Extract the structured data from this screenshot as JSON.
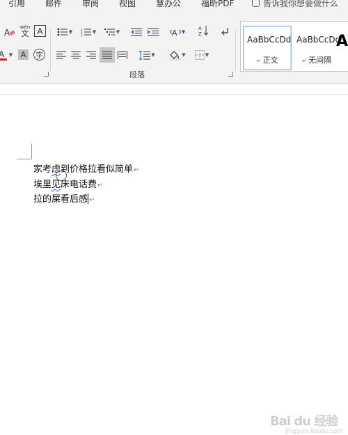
{
  "tabs": [
    "引用",
    "邮件",
    "审阅",
    "视图",
    "慧办公",
    "福昕PDF"
  ],
  "tell_me": "告诉我你想要做什么",
  "font_group": {
    "phonetic_label": "wén",
    "phonetic_char": "文",
    "border_char": "A",
    "shade_char": "A",
    "enclose_char": "字"
  },
  "paragraph_group": {
    "label": "段落",
    "sort_label": "A↓Z"
  },
  "styles": [
    {
      "sample": "AaBbCcDd",
      "name": "正文",
      "active": true
    },
    {
      "sample": "AaBbCcDd",
      "name": "无间隔",
      "active": false
    }
  ],
  "document": {
    "lines": [
      {
        "pre": "家考",
        "squiggle": "虑",
        "post": "到价格拉看似简单"
      },
      {
        "pre": "埃里",
        "squiggle": "见",
        "post": "床电话费"
      },
      {
        "pre": "拉的屎看后感",
        "squiggle": "",
        "post": ""
      }
    ],
    "return_mark": "↵"
  },
  "watermark": {
    "text": "Bai du 经验",
    "sub": "jingyan.baidu.com"
  },
  "colors": {
    "accent": "#2a6fd6",
    "ribbon_bg": "#f3f3f3",
    "justify_active": "#c5c5c5"
  }
}
